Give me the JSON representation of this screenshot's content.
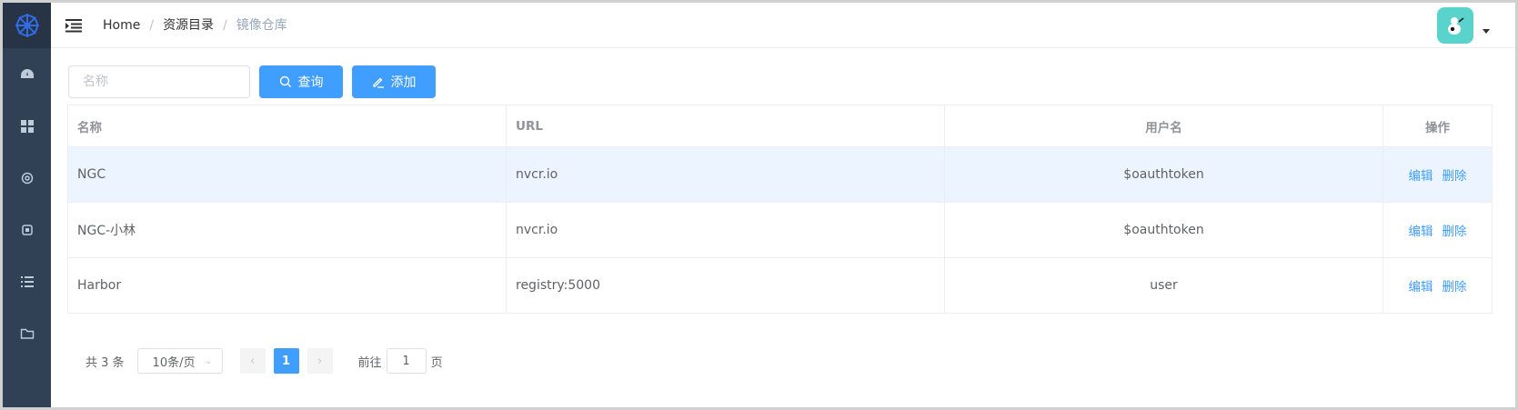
{
  "header": {
    "breadcrumb": [
      "Home",
      "资源目录",
      "镜像仓库"
    ]
  },
  "sidebar": {
    "items": [
      {
        "icon": "dashboard-icon"
      },
      {
        "icon": "grid-icon"
      },
      {
        "icon": "settings-icon"
      },
      {
        "icon": "chip-icon"
      },
      {
        "icon": "list-icon"
      },
      {
        "icon": "folder-icon"
      }
    ]
  },
  "toolbar": {
    "search_placeholder": "名称",
    "search_label": "查询",
    "add_label": "添加"
  },
  "table": {
    "columns": [
      "名称",
      "URL",
      "用户名",
      "操作"
    ],
    "rows": [
      {
        "name": "NGC",
        "url": "nvcr.io",
        "username": "$oauthtoken",
        "edit": "编辑",
        "delete": "删除"
      },
      {
        "name": "NGC-小林",
        "url": "nvcr.io",
        "username": "$oauthtoken",
        "edit": "编辑",
        "delete": "删除"
      },
      {
        "name": "Harbor",
        "url": "registry:5000",
        "username": "user",
        "edit": "编辑",
        "delete": "删除"
      }
    ]
  },
  "pagination": {
    "total": "共 3 条",
    "page_size": "10条/页",
    "current_page": "1",
    "goto_prefix": "前往",
    "goto_value": "1",
    "goto_suffix": "页"
  },
  "colors": {
    "primary": "#409eff",
    "sidebar": "#304156",
    "avatar_bg": "#59d3cc"
  }
}
